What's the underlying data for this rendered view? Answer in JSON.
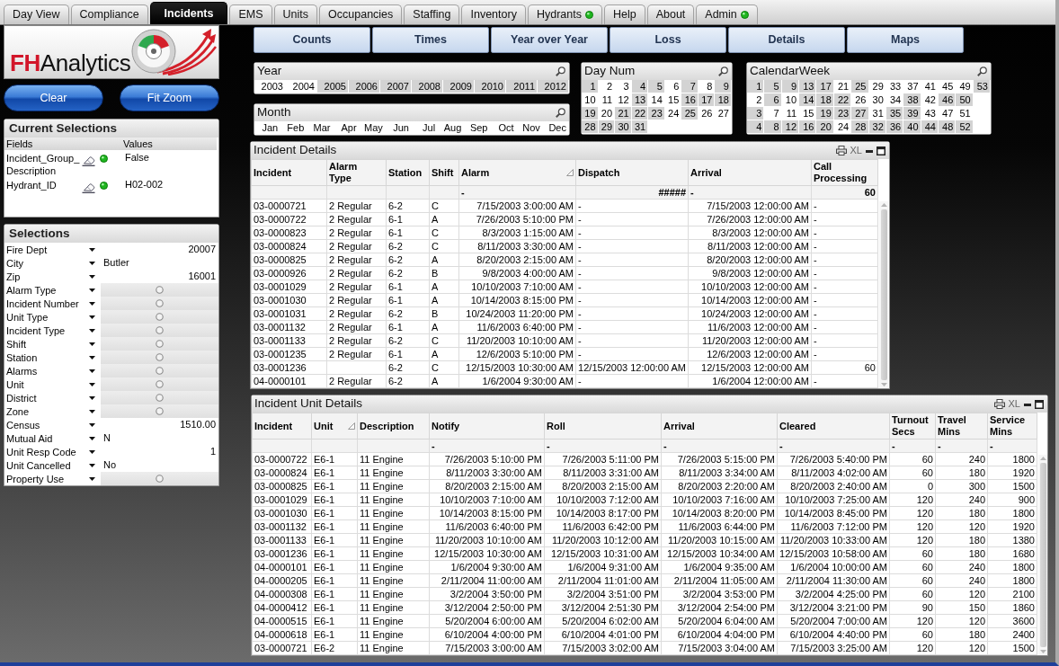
{
  "tabs": [
    {
      "label": "Day View",
      "selected": false,
      "status_dot": false
    },
    {
      "label": "Compliance",
      "selected": false,
      "status_dot": false
    },
    {
      "label": "Incidents",
      "selected": true,
      "status_dot": false
    },
    {
      "label": "EMS",
      "selected": false,
      "status_dot": false
    },
    {
      "label": "Units",
      "selected": false,
      "status_dot": false
    },
    {
      "label": "Occupancies",
      "selected": false,
      "status_dot": false
    },
    {
      "label": "Staffing",
      "selected": false,
      "status_dot": false
    },
    {
      "label": "Inventory",
      "selected": false,
      "status_dot": false
    },
    {
      "label": "Hydrants",
      "selected": false,
      "status_dot": true
    },
    {
      "label": "Help",
      "selected": false,
      "status_dot": false
    },
    {
      "label": "About",
      "selected": false,
      "status_dot": false
    },
    {
      "label": "Admin",
      "selected": false,
      "status_dot": true
    }
  ],
  "logo": {
    "brand": "FH",
    "name": "Analytics"
  },
  "action_buttons": [
    "Clear",
    "Fit Zoom"
  ],
  "current_selections": {
    "title": "Current Selections",
    "columns": [
      "Fields",
      "Values"
    ],
    "rows": [
      {
        "field": "Incident_Group_Description",
        "value": "False"
      },
      {
        "field": "Hydrant_ID",
        "value": "H02-002"
      }
    ]
  },
  "selections": {
    "title": "Selections",
    "rows": [
      {
        "label": "Fire Dept",
        "kind": "number",
        "value": "20007"
      },
      {
        "label": "City",
        "kind": "text",
        "value": "Butler"
      },
      {
        "label": "Zip",
        "kind": "number",
        "value": "16001"
      },
      {
        "label": "Alarm Type",
        "kind": "empty"
      },
      {
        "label": "Incident Number",
        "kind": "empty"
      },
      {
        "label": "Unit Type",
        "kind": "empty"
      },
      {
        "label": "Incident Type",
        "kind": "empty"
      },
      {
        "label": "Shift",
        "kind": "empty"
      },
      {
        "label": "Station",
        "kind": "empty"
      },
      {
        "label": "Alarms",
        "kind": "empty"
      },
      {
        "label": "Unit",
        "kind": "empty"
      },
      {
        "label": "District",
        "kind": "empty"
      },
      {
        "label": "Zone",
        "kind": "empty"
      },
      {
        "label": "Census",
        "kind": "number",
        "value": "1510.00"
      },
      {
        "label": "Mutual Aid",
        "kind": "text",
        "value": "N"
      },
      {
        "label": "Unit Resp Code",
        "kind": "number",
        "value": "1"
      },
      {
        "label": "Unit Cancelled",
        "kind": "text",
        "value": "No"
      },
      {
        "label": "Property Use",
        "kind": "empty"
      }
    ]
  },
  "sheet_buttons": [
    "Counts",
    "Times",
    "Year over Year",
    "Loss",
    "Details",
    "Maps"
  ],
  "list_box_columns": [
    [
      {
        "title": "Year",
        "rows": [
          [
            {
              "text": "2003",
              "excluded": false
            },
            {
              "text": "2004",
              "excluded": false
            },
            {
              "text": "2005",
              "excluded": true
            },
            {
              "text": "2006",
              "excluded": true
            },
            {
              "text": "2007",
              "excluded": true
            },
            {
              "text": "2008",
              "excluded": true
            },
            {
              "text": "2009",
              "excluded": true
            },
            {
              "text": "2010",
              "excluded": true
            },
            {
              "text": "2011",
              "excluded": true
            },
            {
              "text": "2012",
              "excluded": true
            }
          ]
        ]
      },
      {
        "title": "Month",
        "rows": [
          [
            {
              "text": "Jan",
              "excluded": false
            },
            {
              "text": "Feb",
              "excluded": false
            },
            {
              "text": "Mar",
              "excluded": false
            },
            {
              "text": "Apr",
              "excluded": false
            },
            {
              "text": "May",
              "excluded": false
            },
            {
              "text": "Jun",
              "excluded": false
            },
            {
              "text": "Jul",
              "excluded": false
            },
            {
              "text": "Aug",
              "excluded": false
            },
            {
              "text": "Sep",
              "excluded": false
            },
            {
              "text": "Oct",
              "excluded": false
            },
            {
              "text": "Nov",
              "excluded": false
            },
            {
              "text": "Dec",
              "excluded": false
            }
          ]
        ]
      }
    ],
    [
      {
        "title": "Day Num",
        "rows": [
          [
            {
              "text": "1",
              "excluded": true
            },
            {
              "text": "2",
              "excluded": false
            },
            {
              "text": "3",
              "excluded": false
            },
            {
              "text": "4",
              "excluded": true
            },
            {
              "text": "5",
              "excluded": true
            },
            {
              "text": "6",
              "excluded": false
            },
            {
              "text": "7",
              "excluded": true
            },
            {
              "text": "8",
              "excluded": false
            },
            {
              "text": "9",
              "excluded": true
            }
          ],
          [
            {
              "text": "10",
              "excluded": false
            },
            {
              "text": "11",
              "excluded": false
            },
            {
              "text": "12",
              "excluded": false
            },
            {
              "text": "13",
              "excluded": true
            },
            {
              "text": "14",
              "excluded": false
            },
            {
              "text": "15",
              "excluded": false
            },
            {
              "text": "16",
              "excluded": true
            },
            {
              "text": "17",
              "excluded": true
            },
            {
              "text": "18",
              "excluded": true
            }
          ],
          [
            {
              "text": "19",
              "excluded": true
            },
            {
              "text": "20",
              "excluded": false
            },
            {
              "text": "21",
              "excluded": true
            },
            {
              "text": "22",
              "excluded": true
            },
            {
              "text": "23",
              "excluded": true
            },
            {
              "text": "24",
              "excluded": false
            },
            {
              "text": "25",
              "excluded": true
            },
            {
              "text": "26",
              "excluded": false
            },
            {
              "text": "27",
              "excluded": false
            }
          ],
          [
            {
              "text": "28",
              "excluded": true
            },
            {
              "text": "29",
              "excluded": true
            },
            {
              "text": "30",
              "excluded": true
            },
            {
              "text": "31",
              "excluded": true
            }
          ]
        ]
      }
    ],
    [
      {
        "title": "CalendarWeek",
        "rows": [
          [
            {
              "text": "1",
              "excluded": true
            },
            {
              "text": "5",
              "excluded": true
            },
            {
              "text": "9",
              "excluded": true
            },
            {
              "text": "13",
              "excluded": true
            },
            {
              "text": "17",
              "excluded": true
            },
            {
              "text": "21",
              "excluded": false
            },
            {
              "text": "25",
              "excluded": true
            },
            {
              "text": "29",
              "excluded": false
            },
            {
              "text": "33",
              "excluded": false
            },
            {
              "text": "37",
              "excluded": false
            },
            {
              "text": "41",
              "excluded": false
            },
            {
              "text": "45",
              "excluded": false
            },
            {
              "text": "49",
              "excluded": false
            },
            {
              "text": "53",
              "excluded": true
            }
          ],
          [
            {
              "text": "2",
              "excluded": false
            },
            {
              "text": "6",
              "excluded": true
            },
            {
              "text": "10",
              "excluded": false
            },
            {
              "text": "14",
              "excluded": true
            },
            {
              "text": "18",
              "excluded": true
            },
            {
              "text": "22",
              "excluded": true
            },
            {
              "text": "26",
              "excluded": false
            },
            {
              "text": "30",
              "excluded": false
            },
            {
              "text": "34",
              "excluded": false
            },
            {
              "text": "38",
              "excluded": true
            },
            {
              "text": "42",
              "excluded": false
            },
            {
              "text": "46",
              "excluded": true
            },
            {
              "text": "50",
              "excluded": true
            }
          ],
          [
            {
              "text": "3",
              "excluded": true
            },
            {
              "text": "7",
              "excluded": false
            },
            {
              "text": "11",
              "excluded": false
            },
            {
              "text": "15",
              "excluded": false
            },
            {
              "text": "19",
              "excluded": true
            },
            {
              "text": "23",
              "excluded": true
            },
            {
              "text": "27",
              "excluded": true
            },
            {
              "text": "31",
              "excluded": false
            },
            {
              "text": "35",
              "excluded": true
            },
            {
              "text": "39",
              "excluded": true
            },
            {
              "text": "43",
              "excluded": false
            },
            {
              "text": "47",
              "excluded": false
            },
            {
              "text": "51",
              "excluded": false
            }
          ],
          [
            {
              "text": "4",
              "excluded": true
            },
            {
              "text": "8",
              "excluded": true
            },
            {
              "text": "12",
              "excluded": true
            },
            {
              "text": "16",
              "excluded": true
            },
            {
              "text": "20",
              "excluded": true
            },
            {
              "text": "24",
              "excluded": false
            },
            {
              "text": "28",
              "excluded": true
            },
            {
              "text": "32",
              "excluded": true
            },
            {
              "text": "36",
              "excluded": true
            },
            {
              "text": "40",
              "excluded": true
            },
            {
              "text": "44",
              "excluded": true
            },
            {
              "text": "48",
              "excluded": true
            },
            {
              "text": "52",
              "excluded": true
            }
          ]
        ]
      }
    ]
  ],
  "incident_details": {
    "title": "Incident Details",
    "export_label": "XL",
    "columns": [
      {
        "label": "Incident",
        "kind": "text",
        "sorted": false
      },
      {
        "label": "Alarm Type",
        "kind": "text",
        "sorted": false
      },
      {
        "label": "Station",
        "kind": "text",
        "sorted": false
      },
      {
        "label": "Shift",
        "kind": "text",
        "sorted": false
      },
      {
        "label": "Alarm",
        "kind": "number",
        "sorted": true,
        "total": {
          "kind": "missing",
          "text": "-"
        }
      },
      {
        "label": "Dispatch",
        "kind": "number",
        "sorted": false,
        "total": "#####"
      },
      {
        "label": "Arrival",
        "kind": "number",
        "sorted": false,
        "total": {
          "kind": "missing",
          "text": "-"
        }
      },
      {
        "label": "Call Processing",
        "kind": "number",
        "sorted": false,
        "total": "60"
      }
    ],
    "rows": [
      [
        "03-0000721",
        "2 Regular",
        "6-2",
        "C",
        "7/15/2003 3:00:00 AM",
        {
          "kind": "missing",
          "text": "-"
        },
        "7/15/2003 12:00:00 AM",
        {
          "kind": "missing",
          "text": "-"
        }
      ],
      [
        "03-0000722",
        "2 Regular",
        "6-1",
        "A",
        "7/26/2003 5:10:00 PM",
        {
          "kind": "missing",
          "text": "-"
        },
        "7/26/2003 12:00:00 AM",
        {
          "kind": "missing",
          "text": "-"
        }
      ],
      [
        "03-0000823",
        "2 Regular",
        "6-1",
        "C",
        "8/3/2003 1:15:00 AM",
        {
          "kind": "missing",
          "text": "-"
        },
        "8/3/2003 12:00:00 AM",
        {
          "kind": "missing",
          "text": "-"
        }
      ],
      [
        "03-0000824",
        "2 Regular",
        "6-2",
        "C",
        "8/11/2003 3:30:00 AM",
        {
          "kind": "missing",
          "text": "-"
        },
        "8/11/2003 12:00:00 AM",
        {
          "kind": "missing",
          "text": "-"
        }
      ],
      [
        "03-0000825",
        "2 Regular",
        "6-2",
        "A",
        "8/20/2003 2:15:00 AM",
        {
          "kind": "missing",
          "text": "-"
        },
        "8/20/2003 12:00:00 AM",
        {
          "kind": "missing",
          "text": "-"
        }
      ],
      [
        "03-0000926",
        "2 Regular",
        "6-2",
        "B",
        "9/8/2003 4:00:00 AM",
        {
          "kind": "missing",
          "text": "-"
        },
        "9/8/2003 12:00:00 AM",
        {
          "kind": "missing",
          "text": "-"
        }
      ],
      [
        "03-0001029",
        "2 Regular",
        "6-1",
        "A",
        "10/10/2003 7:10:00 AM",
        {
          "kind": "missing",
          "text": "-"
        },
        "10/10/2003 12:00:00 AM",
        {
          "kind": "missing",
          "text": "-"
        }
      ],
      [
        "03-0001030",
        "2 Regular",
        "6-1",
        "A",
        "10/14/2003 8:15:00 PM",
        {
          "kind": "missing",
          "text": "-"
        },
        "10/14/2003 12:00:00 AM",
        {
          "kind": "missing",
          "text": "-"
        }
      ],
      [
        "03-0001031",
        "2 Regular",
        "6-2",
        "B",
        "10/24/2003 11:20:00 PM",
        {
          "kind": "missing",
          "text": "-"
        },
        "10/24/2003 12:00:00 AM",
        {
          "kind": "missing",
          "text": "-"
        }
      ],
      [
        "03-0001132",
        "2 Regular",
        "6-1",
        "A",
        "11/6/2003 6:40:00 PM",
        {
          "kind": "missing",
          "text": "-"
        },
        "11/6/2003 12:00:00 AM",
        {
          "kind": "missing",
          "text": "-"
        }
      ],
      [
        "03-0001133",
        "2 Regular",
        "6-2",
        "C",
        "11/20/2003 10:10:00 AM",
        {
          "kind": "missing",
          "text": "-"
        },
        "11/20/2003 12:00:00 AM",
        {
          "kind": "missing",
          "text": "-"
        }
      ],
      [
        "03-0001235",
        "2 Regular",
        "6-1",
        "A",
        "12/6/2003 5:10:00 PM",
        {
          "kind": "missing",
          "text": "-"
        },
        "12/6/2003 12:00:00 AM",
        {
          "kind": "missing",
          "text": "-"
        }
      ],
      [
        "03-0001236",
        null,
        "6-2",
        "C",
        "12/15/2003 10:30:00 AM",
        "12/15/2003 12:00:00 AM",
        "12/15/2003 12:00:00 AM",
        "60"
      ],
      [
        "04-0000101",
        "2 Regular",
        "6-2",
        "A",
        "1/6/2004 9:30:00 AM",
        {
          "kind": "missing",
          "text": "-"
        },
        "1/6/2004 12:00:00 AM",
        {
          "kind": "missing",
          "text": "-"
        }
      ]
    ]
  },
  "incident_unit_details": {
    "title": "Incident Unit Details",
    "export_label": "XL",
    "columns": [
      {
        "label": "Incident",
        "kind": "text",
        "sorted": false
      },
      {
        "label": "Unit",
        "kind": "text",
        "sorted": true
      },
      {
        "label": "Description",
        "kind": "text",
        "sorted": false
      },
      {
        "label": "Notify",
        "kind": "number",
        "sorted": false,
        "total": {
          "kind": "missing",
          "text": "-"
        }
      },
      {
        "label": "Roll",
        "kind": "number",
        "sorted": false,
        "total": {
          "kind": "missing",
          "text": "-"
        }
      },
      {
        "label": "Arrival",
        "kind": "number",
        "sorted": false,
        "total": {
          "kind": "missing",
          "text": "-"
        }
      },
      {
        "label": "Cleared",
        "kind": "number",
        "sorted": false,
        "total": {
          "kind": "missing",
          "text": "-"
        }
      },
      {
        "label": "Turnout Secs",
        "kind": "number",
        "sorted": false,
        "total": {
          "kind": "missing",
          "text": "-"
        }
      },
      {
        "label": "Travel Mins",
        "kind": "number",
        "sorted": false,
        "total": {
          "kind": "missing",
          "text": "-"
        }
      },
      {
        "label": "Service Mins",
        "kind": "number",
        "sorted": false,
        "total": {
          "kind": "missing",
          "text": "-"
        }
      }
    ],
    "rows": [
      [
        "03-0000722",
        "E6-1",
        "11 Engine",
        "7/26/2003 5:10:00 PM",
        "7/26/2003 5:11:00 PM",
        "7/26/2003 5:15:00 PM",
        "7/26/2003 5:40:00 PM",
        "60",
        "240",
        "1800"
      ],
      [
        "03-0000824",
        "E6-1",
        "11 Engine",
        "8/11/2003 3:30:00 AM",
        "8/11/2003 3:31:00 AM",
        "8/11/2003 3:34:00 AM",
        "8/11/2003 4:02:00 AM",
        "60",
        "180",
        "1920"
      ],
      [
        "03-0000825",
        "E6-1",
        "11 Engine",
        "8/20/2003 2:15:00 AM",
        "8/20/2003 2:15:00 AM",
        "8/20/2003 2:20:00 AM",
        "8/20/2003 2:40:00 AM",
        "0",
        "300",
        "1500"
      ],
      [
        "03-0001029",
        "E6-1",
        "11 Engine",
        "10/10/2003 7:10:00 AM",
        "10/10/2003 7:12:00 AM",
        "10/10/2003 7:16:00 AM",
        "10/10/2003 7:25:00 AM",
        "120",
        "240",
        "900"
      ],
      [
        "03-0001030",
        "E6-1",
        "11 Engine",
        "10/14/2003 8:15:00 PM",
        "10/14/2003 8:17:00 PM",
        "10/14/2003 8:20:00 PM",
        "10/14/2003 8:45:00 PM",
        "120",
        "180",
        "1800"
      ],
      [
        "03-0001132",
        "E6-1",
        "11 Engine",
        "11/6/2003 6:40:00 PM",
        "11/6/2003 6:42:00 PM",
        "11/6/2003 6:44:00 PM",
        "11/6/2003 7:12:00 PM",
        "120",
        "120",
        "1920"
      ],
      [
        "03-0001133",
        "E6-1",
        "11 Engine",
        "11/20/2003 10:10:00 AM",
        "11/20/2003 10:12:00 AM",
        "11/20/2003 10:15:00 AM",
        "11/20/2003 10:33:00 AM",
        "120",
        "180",
        "1380"
      ],
      [
        "03-0001236",
        "E6-1",
        "11 Engine",
        "12/15/2003 10:30:00 AM",
        "12/15/2003 10:31:00 AM",
        "12/15/2003 10:34:00 AM",
        "12/15/2003 10:58:00 AM",
        "60",
        "180",
        "1680"
      ],
      [
        "04-0000101",
        "E6-1",
        "11 Engine",
        "1/6/2004 9:30:00 AM",
        "1/6/2004 9:31:00 AM",
        "1/6/2004 9:35:00 AM",
        "1/6/2004 10:00:00 AM",
        "60",
        "240",
        "1800"
      ],
      [
        "04-0000205",
        "E6-1",
        "11 Engine",
        "2/11/2004 11:00:00 AM",
        "2/11/2004 11:01:00 AM",
        "2/11/2004 11:05:00 AM",
        "2/11/2004 11:30:00 AM",
        "60",
        "240",
        "1800"
      ],
      [
        "04-0000308",
        "E6-1",
        "11 Engine",
        "3/2/2004 3:50:00 PM",
        "3/2/2004 3:51:00 PM",
        "3/2/2004 3:53:00 PM",
        "3/2/2004 4:25:00 PM",
        "60",
        "120",
        "2100"
      ],
      [
        "04-0000412",
        "E6-1",
        "11 Engine",
        "3/12/2004 2:50:00 PM",
        "3/12/2004 2:51:30 PM",
        "3/12/2004 2:54:00 PM",
        "3/12/2004 3:21:00 PM",
        "90",
        "150",
        "1860"
      ],
      [
        "04-0000515",
        "E6-1",
        "11 Engine",
        "5/20/2004 6:00:00 AM",
        "5/20/2004 6:02:00 AM",
        "5/20/2004 6:04:00 AM",
        "5/20/2004 7:00:00 AM",
        "120",
        "120",
        "3600"
      ],
      [
        "04-0000618",
        "E6-1",
        "11 Engine",
        "6/10/2004 4:00:00 PM",
        "6/10/2004 4:01:00 PM",
        "6/10/2004 4:04:00 PM",
        "6/10/2004 4:40:00 PM",
        "60",
        "180",
        "2400"
      ],
      [
        "03-0000721",
        "E6-2",
        "11 Engine",
        "7/15/2003 3:00:00 AM",
        "7/15/2003 3:02:00 AM",
        "7/15/2003 3:04:00 AM",
        "7/15/2003 3:25:00 AM",
        "120",
        "120",
        "1500"
      ]
    ]
  }
}
